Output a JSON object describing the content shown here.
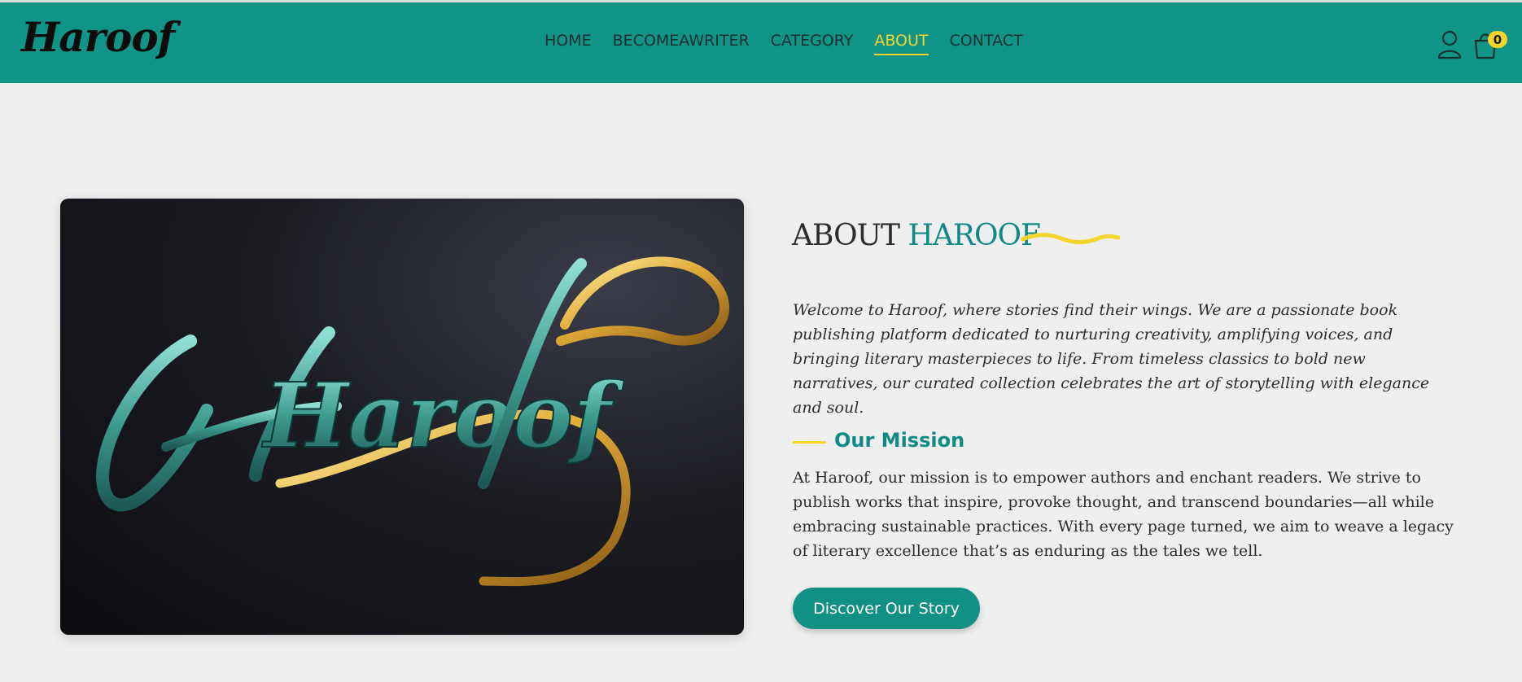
{
  "brand": {
    "logo_text": "Haroof"
  },
  "nav": {
    "items": [
      {
        "label": "HOME"
      },
      {
        "label": "BECOMEAWRITER"
      },
      {
        "label": "CATEGORY"
      },
      {
        "label": "ABOUT",
        "active": true
      },
      {
        "label": "CONTACT"
      }
    ]
  },
  "header_icons": {
    "user_icon": "user-icon",
    "bag_icon": "shopping-bag-icon",
    "cart_count": "0"
  },
  "hero_image": {
    "logo_text": "Haroof"
  },
  "about": {
    "title_prefix": "ABOUT",
    "title_brand": "HAROOF",
    "intro": "Welcome to Haroof, where stories find their wings. We are a passionate book publishing platform dedicated to nurturing creativity, amplifying voices, and bringing literary masterpieces to life. From timeless classics to bold new narratives, our curated collection celebrates the art of storytelling with elegance and soul.",
    "mission_title": "Our Mission",
    "mission_text": "At Haroof, our mission is to empower authors and enchant readers. We strive to publish works that inspire, provoke thought, and transcend boundaries—all while embracing sustainable practices. With every page turned, we aim to weave a legacy of literary excellence that’s as enduring as the tales we tell.",
    "cta_label": "Discover Our Story"
  },
  "colors": {
    "header_bg": "#109488",
    "accent_yellow": "#f4d52b",
    "brand_teal": "#118a86",
    "page_bg": "#efefef"
  }
}
